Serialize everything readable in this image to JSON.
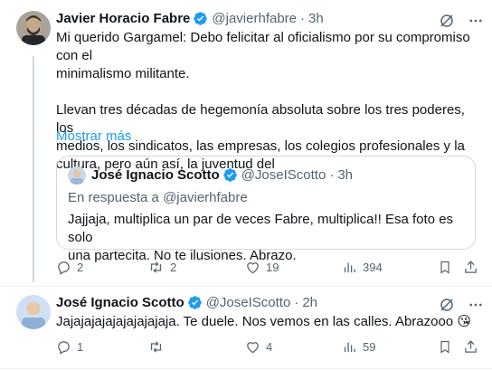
{
  "tweet1": {
    "author_name": "Javier Horacio Fabre",
    "handle": "@javierhfabre",
    "time": "3h",
    "text_line1": "Mi querido Gargamel: Debo felicitar al oficialismo por su compromiso con el",
    "text_line2": "minimalismo militante.",
    "text_line3": "Llevan tres décadas de hegemonía absoluta sobre los tres poderes, los",
    "text_line4": "medios, los sindicatos, las empresas, los colegios profesionales y la",
    "text_line5": "cultura, pero aún así, la juventud del",
    "show_more": "Mostrar más",
    "quote": {
      "author_name": "José Ignacio Scotto",
      "handle": "@JoseIScotto",
      "time": "3h",
      "reply_prefix": "En respuesta a",
      "reply_to": "@javierhfabre",
      "text_line1": "Jajjaja, multiplica un par de veces Fabre, multiplica!! Esa foto es solo",
      "text_line2": "una partecita. No te ilusiones. Abrazo."
    },
    "replies": "2",
    "retweets": "2",
    "likes": "19",
    "views": "394"
  },
  "tweet2": {
    "author_name": "José Ignacio Scotto",
    "handle": "@JoseIScotto",
    "time": "2h",
    "text": "Jajajajajajajajajajaja. Te duele. Nos vemos en las calles. Abrazooo 😘",
    "replies": "1",
    "retweets": "",
    "likes": "4",
    "views": "59"
  },
  "colors": {
    "verified": "#1d9bf0",
    "link": "#1d9bf0",
    "secondary_text": "#536471",
    "border": "#cfd9de"
  },
  "icons": [
    "verified-badge-icon",
    "grok-icon",
    "more-icon",
    "reply-icon",
    "retweet-icon",
    "like-icon",
    "views-icon",
    "bookmark-icon",
    "share-icon"
  ]
}
